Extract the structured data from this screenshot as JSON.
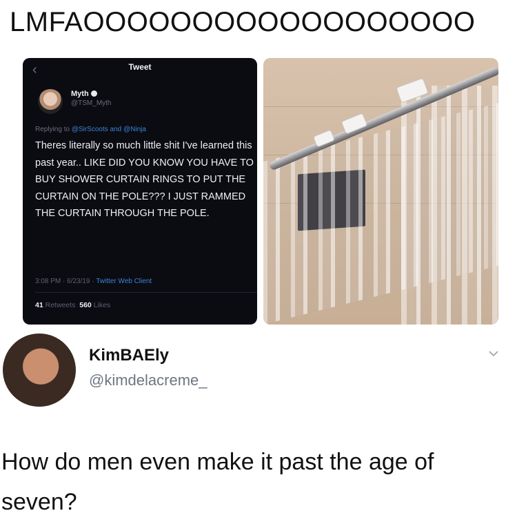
{
  "caption": "LMFAOOOOOOOOOOOOOOOOOO",
  "embedded_tweet": {
    "header_title": "Tweet",
    "author_name": "Myth",
    "author_handle": "@TSM_Myth",
    "replying_prefix": "Replying to ",
    "replying_to": "@SirScoots and @Ninja",
    "text": "Theres literally so much little shit I've learned this past year.. LIKE DID YOU KNOW YOU HAVE TO BUY SHOWER CURTAIN RINGS TO PUT THE CURTAIN ON THE POLE??? I JUST RAMMED THE CURTAIN THROUGH THE POLE.",
    "timestamp": "3:08 PM · 6/23/19 · ",
    "client": "Twitter Web Client",
    "retweets_count": "41",
    "retweets_label": "Retweets",
    "likes_count": "560",
    "likes_label": "Likes"
  },
  "reply": {
    "display_name": "KimBAEly",
    "handle": "@kimdelacreme_",
    "text": "How do men even make it past the age of seven?"
  },
  "colors": {
    "link_blue": "#3a85d8",
    "dark_bg": "#0b0b12",
    "handle_gray": "#6d7680"
  }
}
